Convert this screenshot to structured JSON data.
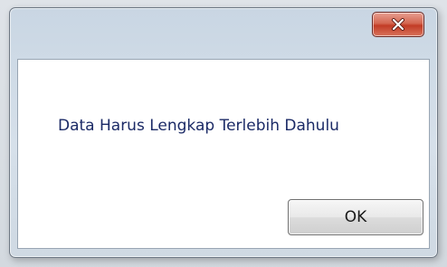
{
  "dialog": {
    "message": "Data Harus Lengkap Terlebih Dahulu",
    "ok_label": "OK",
    "close_icon": "close-icon"
  },
  "colors": {
    "close_button": "#c9432d",
    "message_text": "#1b2a66",
    "frame": "#cfd9e3"
  }
}
